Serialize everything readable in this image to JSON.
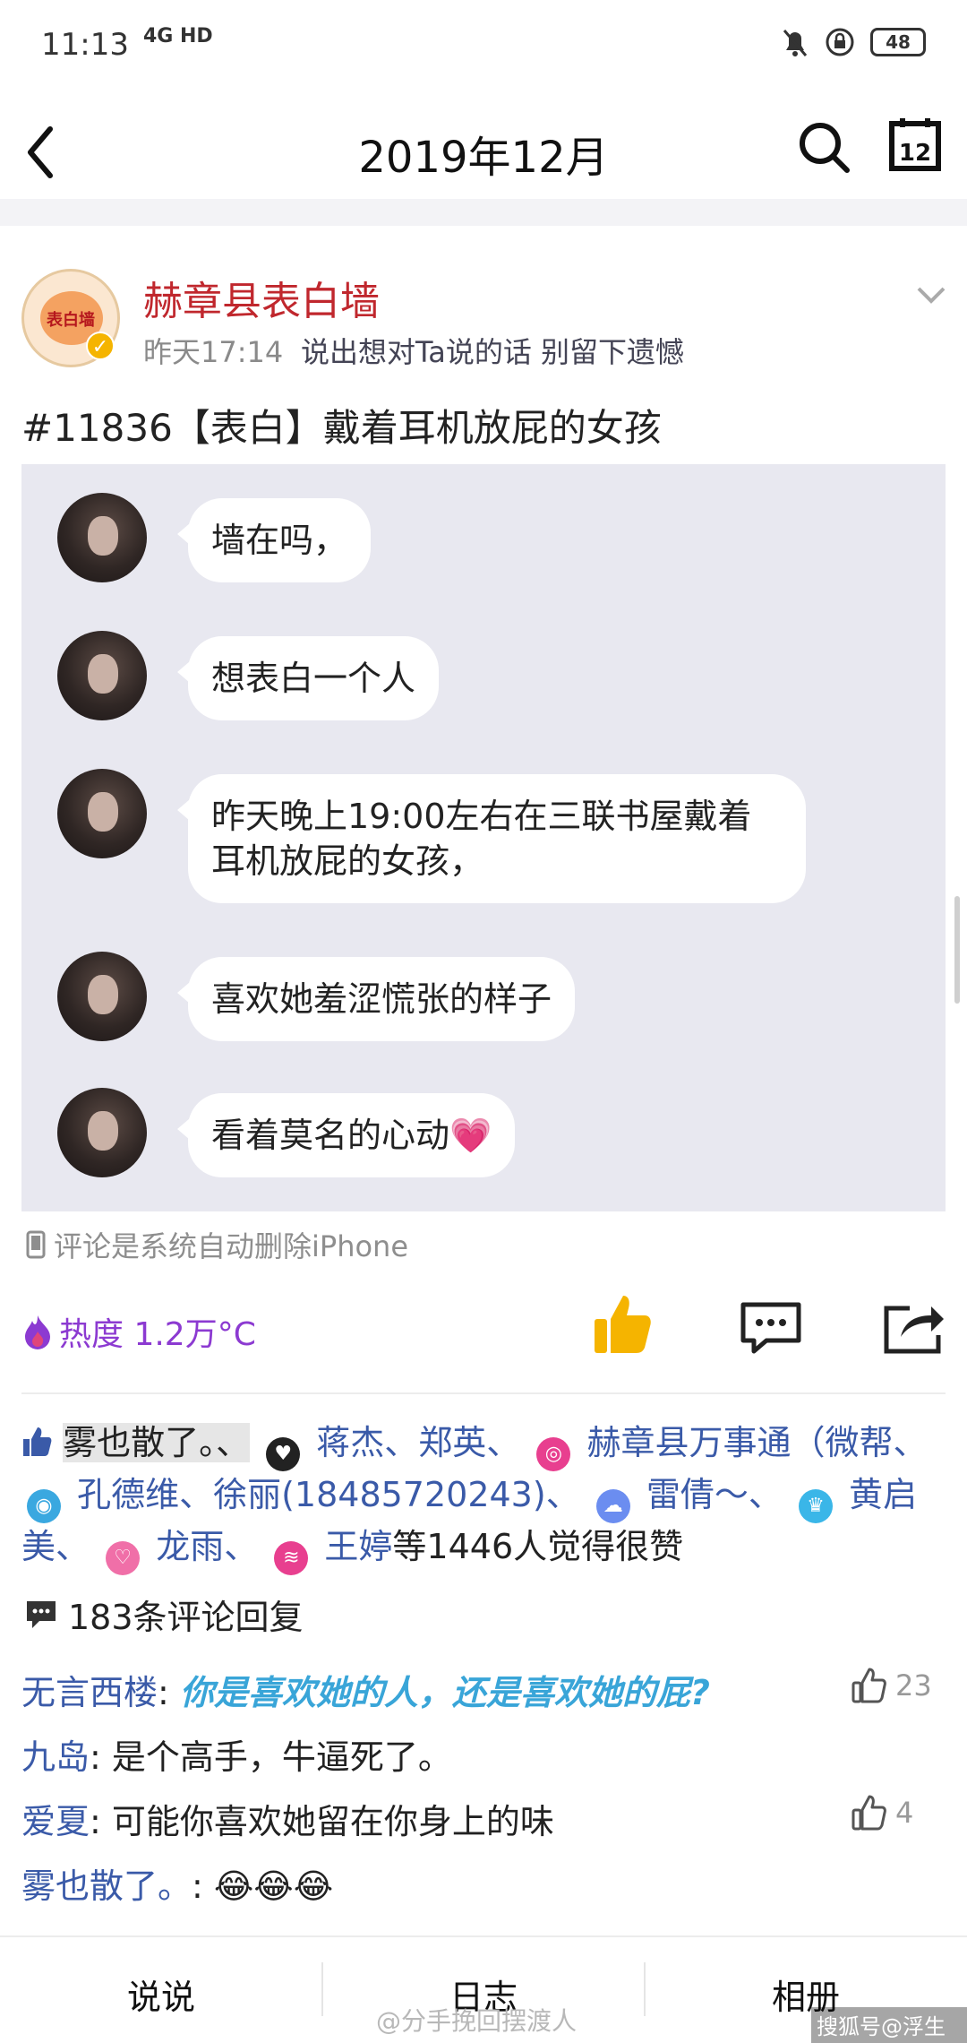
{
  "status_bar": {
    "time": "11:13",
    "network": "4G HD",
    "battery": "48"
  },
  "header": {
    "title": "2019年12月"
  },
  "post": {
    "author": "赫章县表白墙",
    "avatar_text": "表白墙",
    "time": "昨天17:14",
    "signature": "说出想对Ta说的话 别留下遗憾",
    "text": "#11836【表白】戴着耳机放屁的女孩",
    "chat_messages": [
      "墙在吗，",
      "想表白一个人",
      "昨天晚上19:00左右在三联书屋戴着耳机放屁的女孩，",
      "喜欢她羞涩慌张的样子",
      "看着莫名的心动💗"
    ],
    "device": "评论是系统自动删除iPhone"
  },
  "actions": {
    "heat": "热度 1.2万°C"
  },
  "likes": {
    "names": [
      "雾也散了。、",
      "蒋杰、郑英、",
      "赫章县万事通（微帮、",
      "孔德维、徐丽(18485720243)、",
      "雷倩～、",
      "黄启美、",
      "龙雨、",
      "王婷"
    ],
    "suffix": "等1446人觉得很赞"
  },
  "comments_summary": "183条评论回复",
  "comments": [
    {
      "author": "无言西楼",
      "text": "你是喜欢她的人，还是喜欢她的屁?",
      "likes": "23"
    },
    {
      "author": "九岛",
      "text": "是个高手，牛逼死了。",
      "likes": ""
    },
    {
      "author": "爱夏",
      "text": "可能你喜欢她留在你身上的味",
      "likes": "4"
    },
    {
      "author": "雾也散了。",
      "text": "😂😂😂",
      "likes": ""
    }
  ],
  "tabs": [
    "说说",
    "日志",
    "相册"
  ],
  "watermarks": [
    "@分手挽回摆渡人",
    "搜狐号@浮生DI"
  ],
  "colors": {
    "author": "#c0272d",
    "link": "#3a5aa8",
    "heat": "#8c3ad1",
    "hot_comment": "#39a5d8",
    "like_icon": "#f5b400"
  }
}
